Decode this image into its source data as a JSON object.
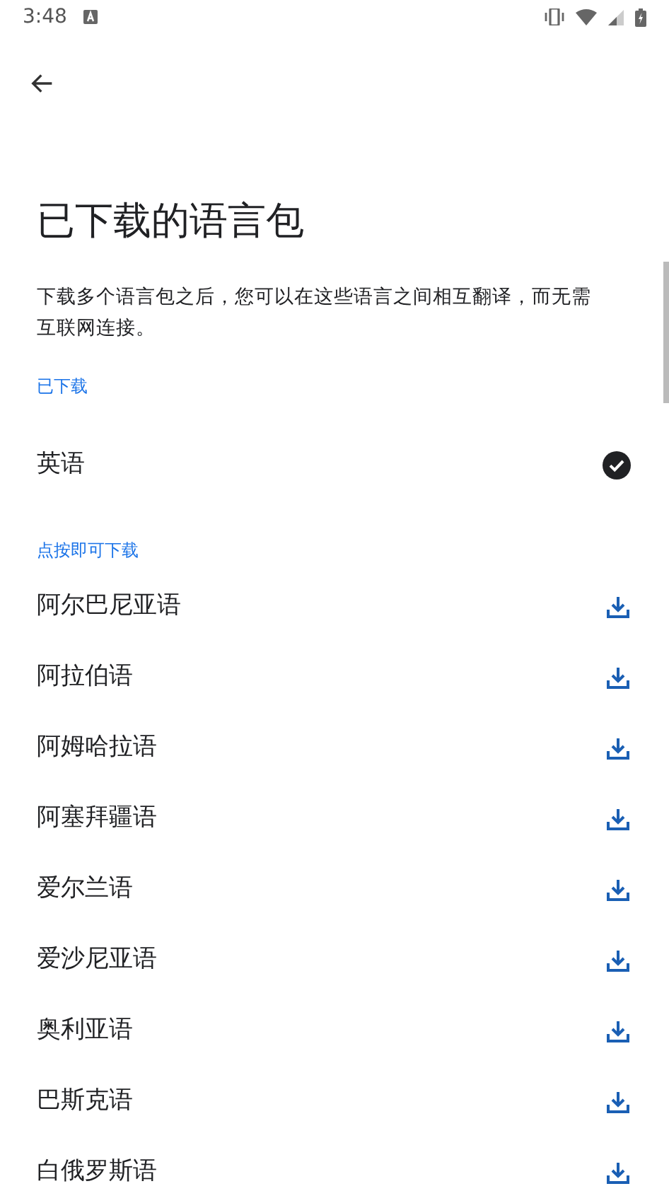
{
  "status_bar": {
    "time": "3:48"
  },
  "title": "已下载的语言包",
  "description": "下载多个语言包之后，您可以在这些语言之间相互翻译，而无需互联网连接。",
  "sections": [
    {
      "label": "已下载",
      "items": [
        {
          "name": "英语",
          "downloaded": true
        }
      ]
    },
    {
      "label": "点按即可下载",
      "items": [
        {
          "name": "阿尔巴尼亚语",
          "downloaded": false
        },
        {
          "name": "阿拉伯语",
          "downloaded": false
        },
        {
          "name": "阿姆哈拉语",
          "downloaded": false
        },
        {
          "name": "阿塞拜疆语",
          "downloaded": false
        },
        {
          "name": "爱尔兰语",
          "downloaded": false
        },
        {
          "name": "爱沙尼亚语",
          "downloaded": false
        },
        {
          "name": "奥利亚语",
          "downloaded": false
        },
        {
          "name": "巴斯克语",
          "downloaded": false
        },
        {
          "name": "白俄罗斯语",
          "downloaded": false
        }
      ]
    }
  ]
}
